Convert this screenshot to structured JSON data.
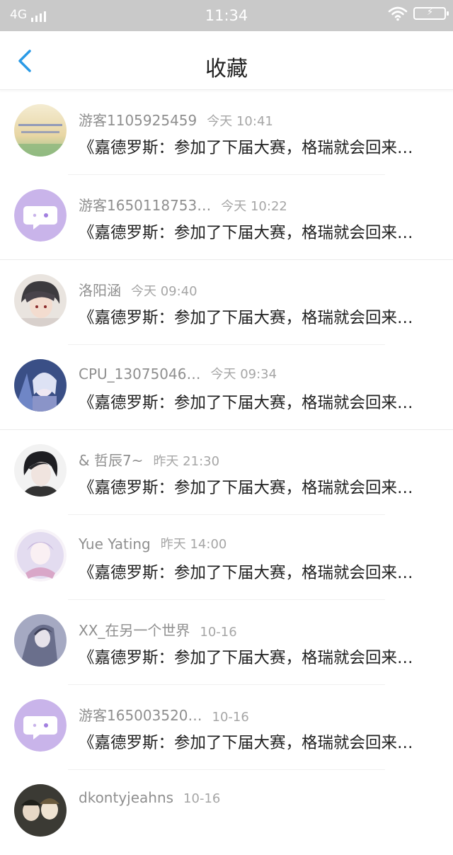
{
  "status_bar": {
    "network": "4G",
    "time": "11:34"
  },
  "header": {
    "title": "收藏"
  },
  "items": [
    {
      "user": "游客1105925459",
      "time": "今天 10:41",
      "message": "《嘉德罗斯：参加了下届大赛，格瑞就会回来…",
      "avatar": "landscape-text-avatar"
    },
    {
      "user": "游客1650118753…",
      "time": "今天 10:22",
      "message": "《嘉德罗斯：参加了下届大赛，格瑞就会回来…",
      "avatar": "default-chat-avatar"
    },
    {
      "user": "洛阳涵",
      "time": "今天 09:40",
      "message": "《嘉德罗斯：参加了下届大赛，格瑞就会回来…",
      "avatar": "anime-boy-avatar"
    },
    {
      "user": "CPU_13075046…",
      "time": "今天 09:34",
      "message": "《嘉德罗斯：参加了下届大赛，格瑞就会回来…",
      "avatar": "anime-blue-avatar"
    },
    {
      "user": "& 哲辰7~",
      "time": "昨天 21:30",
      "message": "《嘉德罗斯：参加了下届大赛，格瑞就会回来…",
      "avatar": "anime-dark-avatar"
    },
    {
      "user": "Yue Yating",
      "time": "昨天 14:00",
      "message": "《嘉德罗斯：参加了下届大赛，格瑞就会回来…",
      "avatar": "anime-pink-avatar"
    },
    {
      "user": "XX_在另一个世界",
      "time": "10-16",
      "message": "《嘉德罗斯：参加了下届大赛，格瑞就会回来…",
      "avatar": "anime-grey-avatar"
    },
    {
      "user": "游客165003520…",
      "time": "10-16",
      "message": "《嘉德罗斯：参加了下届大赛，格瑞就会回来…",
      "avatar": "default-chat-avatar"
    },
    {
      "user": "dkontyjeahns",
      "time": "10-16",
      "message": "",
      "avatar": "anime-group-avatar"
    }
  ]
}
